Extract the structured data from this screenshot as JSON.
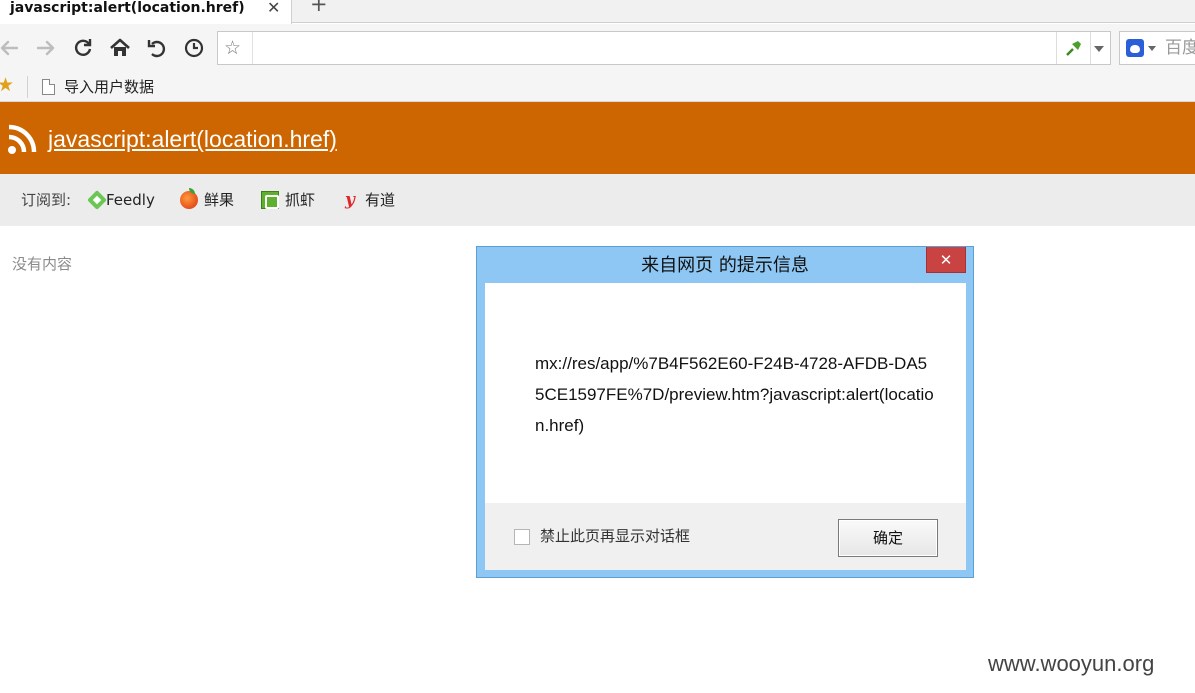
{
  "tab": {
    "title": "javascript:alert(location.href)",
    "close_glyph": "✕",
    "new_tab_glyph": "+"
  },
  "toolbar": {
    "back_icon": "back-arrow-icon",
    "forward_icon": "forward-arrow-icon",
    "refresh_icon": "refresh-icon",
    "home_icon": "home-icon",
    "undo_icon": "undo-icon",
    "history_icon": "history-clock-icon",
    "address": {
      "star_glyph": "☆",
      "value": "",
      "placeholder": ""
    },
    "search": {
      "placeholder": "百度"
    }
  },
  "bookmarks": {
    "star_glyph": "★",
    "items": [
      {
        "label": "导入用户数据"
      }
    ]
  },
  "feed": {
    "title": "javascript:alert(location.href)",
    "subscribe_label": "订阅到:",
    "subscribe_services": [
      {
        "label": "Feedly"
      },
      {
        "label": "鲜果"
      },
      {
        "label": "抓虾"
      },
      {
        "label": "有道",
        "glyph": "y"
      }
    ],
    "empty_text": "没有内容"
  },
  "dialog": {
    "title": "来自网页  的提示信息",
    "close_glyph": "✕",
    "message": "mx://res/app/%7B4F562E60-F24B-4728-AFDB-DA55CE1597FE%7D/preview.htm?javascript:alert(location.href)",
    "checkbox_label": "禁止此页再显示对话框",
    "checkbox_checked": false,
    "ok_label": "确定"
  },
  "watermark": "www.wooyun.org",
  "colors": {
    "feed_header": "#cd6500",
    "dialog_frame": "#8ec7f3",
    "dialog_close": "#c94343",
    "subscribe_bar": "#ececec"
  }
}
